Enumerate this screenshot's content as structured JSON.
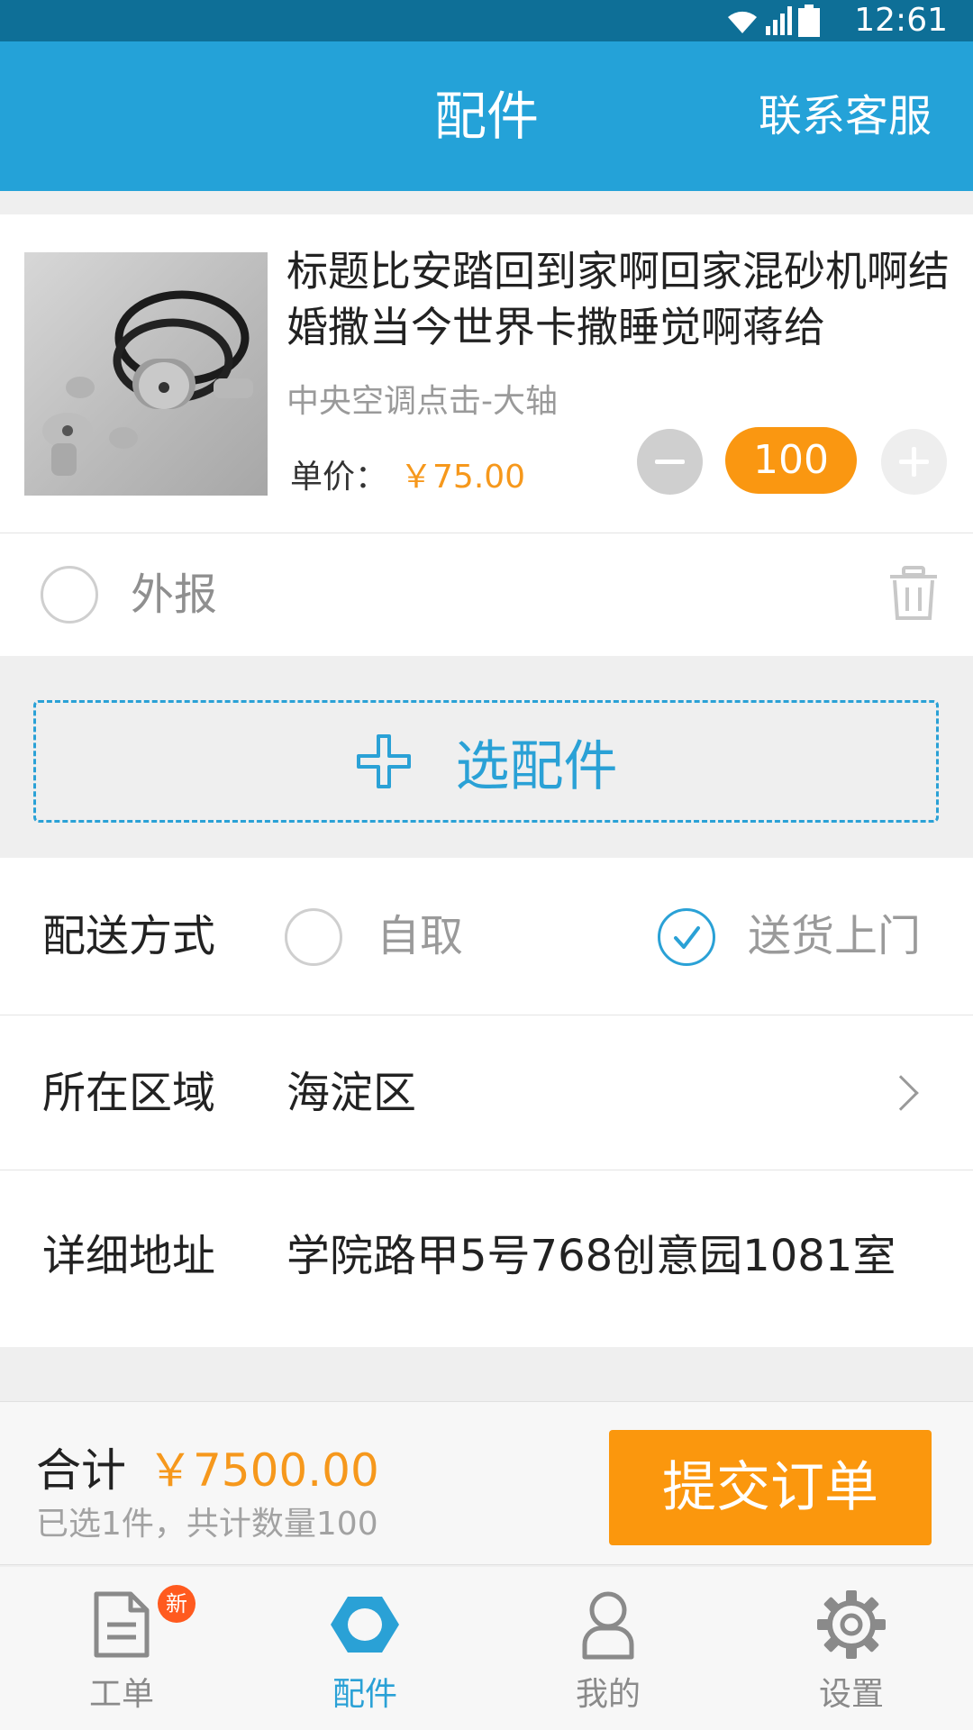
{
  "status_bar": {
    "time": "12:61"
  },
  "app_bar": {
    "title": "配件",
    "action": "联系客服"
  },
  "product": {
    "title": "标题比安踏回到家啊回家混砂机啊结婚撒当今世界卡撒睡觉啊蒋给",
    "subtitle": "中央空调点击-大轴",
    "price_label": "单价：",
    "price_value": "￥75.00",
    "quantity": "100"
  },
  "report": {
    "label": "外报"
  },
  "add_part": {
    "label": "选配件"
  },
  "delivery": {
    "label": "配送方式",
    "options": [
      {
        "label": "自取",
        "selected": false
      },
      {
        "label": "送货上门",
        "selected": true
      }
    ]
  },
  "region": {
    "label": "所在区域",
    "value": "海淀区"
  },
  "address": {
    "label": "详细地址",
    "value": "学院路甲5号768创意园1081室"
  },
  "summary": {
    "total_label": "合计",
    "total_amount": "￥7500.00",
    "detail": "已选1件，共计数量100",
    "submit_label": "提交订单"
  },
  "tabs": [
    {
      "label": "工单",
      "icon": "document-icon",
      "badge": "新"
    },
    {
      "label": "配件",
      "icon": "hexagon-icon",
      "active": true
    },
    {
      "label": "我的",
      "icon": "person-icon"
    },
    {
      "label": "设置",
      "icon": "gear-icon"
    }
  ],
  "colors": {
    "primary": "#24a2d8",
    "status_bar": "#0e6f97",
    "accent": "#fb970d"
  }
}
